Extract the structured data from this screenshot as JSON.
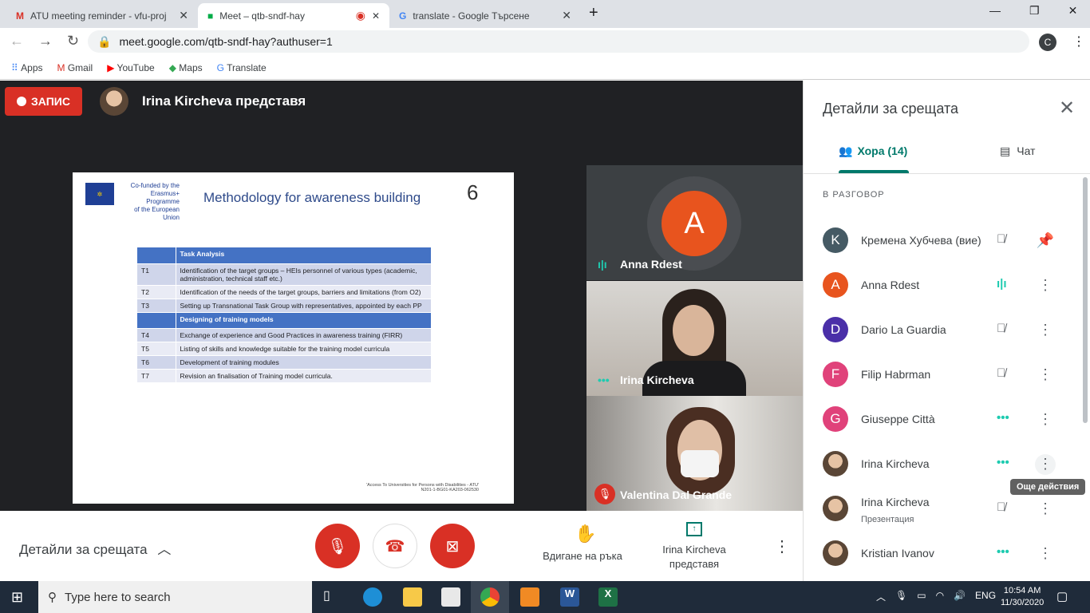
{
  "browser": {
    "tabs": [
      {
        "title": "ATU meeting reminder - vfu-proj",
        "icon": "gmail-icon"
      },
      {
        "title": "Meet – qtb-sndf-hay",
        "icon": "meet-icon",
        "recording": true
      },
      {
        "title": "translate - Google Търсене",
        "icon": "google-icon"
      }
    ],
    "url": "meet.google.com/qtb-sndf-hay?authuser=1",
    "profile": "C",
    "bookmarks": [
      "Apps",
      "Gmail",
      "YouTube",
      "Maps",
      "Translate"
    ]
  },
  "meeting": {
    "record_label": "ЗАПИС",
    "presenter_label": "Irina Kircheva представя",
    "slide": {
      "cofunded": [
        "Co-funded by the",
        "Erasmus+ Programme",
        "of the European Union"
      ],
      "title": "Methodology for awareness building",
      "rows": [
        [
          "",
          "Task Analysis"
        ],
        [
          "T1",
          "Identification of the target groups – HEIs personnel of various types (academic, administration, technical staff etc.)"
        ],
        [
          "T2",
          "Identification of the needs of the target groups, barriers and limitations (from O2)"
        ],
        [
          "T3",
          "Setting up Transnational Task Group with representatives, appointed by each PP"
        ],
        [
          "",
          "Designing of training models"
        ],
        [
          "T4",
          "Exchange of experience and Good Practices in awareness training (FIRR)"
        ],
        [
          "T5",
          "Listing of skills and knowledge suitable for the training model curricula"
        ],
        [
          "T6",
          "Development of training modules"
        ],
        [
          "T7",
          "Revision an finalisation of Training model curricula."
        ]
      ],
      "footer": [
        "'Access To Universities for Persons with Disabilities - ATU'",
        "N201-1-BG01-KA203-062530"
      ]
    },
    "tiles": [
      {
        "name": "Anna Rdest",
        "initial": "A",
        "color": "#e8541e"
      },
      {
        "name": "Irina Kircheva"
      },
      {
        "name": "Valentina Dal Grande"
      }
    ]
  },
  "panel": {
    "title": "Детайли за срещата",
    "tab_people": "Хора (14)",
    "tab_chat": "Чат",
    "section": "В РАЗГОВОР",
    "people": [
      {
        "name": "Кремена Хубчева (вие)",
        "initial": "K",
        "color": "#455a64",
        "status": "muted"
      },
      {
        "name": "Anna Rdest",
        "initial": "A",
        "color": "#e8541e",
        "status": "speaking"
      },
      {
        "name": "Dario La Guardia",
        "initial": "D",
        "color": "#4a2fa8",
        "status": "muted"
      },
      {
        "name": "Filip Habrman",
        "initial": "F",
        "color": "#e0427a",
        "status": "muted"
      },
      {
        "name": "Giuseppe Città",
        "initial": "G",
        "color": "#e0427a",
        "status": "active"
      },
      {
        "name": "Irina Kircheva",
        "status": "active"
      },
      {
        "name": "Irina Kircheva",
        "sub": "Презентация",
        "status": "muted"
      },
      {
        "name": "Kristian Ivanov",
        "status": "active"
      }
    ],
    "tooltip": "Още действия"
  },
  "controls": {
    "details": "Детайли за срещата",
    "raise_hand": "Вдигане на ръка",
    "presenting": [
      "Irina Kircheva",
      "представя"
    ]
  },
  "taskbar": {
    "search": "Type here to search",
    "lang": "ENG",
    "time": "10:54 AM",
    "date": "11/30/2020"
  }
}
